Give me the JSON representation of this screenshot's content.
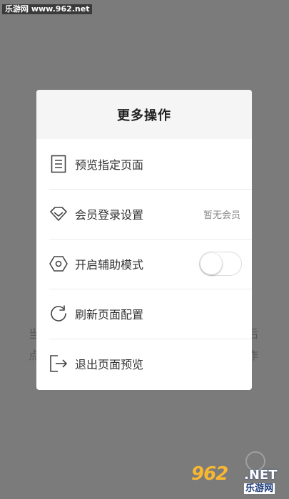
{
  "watermark": {
    "top": "乐游网 www.962.net",
    "bottom_logo": "962",
    "bottom_net": ".NET",
    "bottom_cn": "乐游网"
  },
  "background": {
    "left_1": "当",
    "left_2": "点",
    "right_1": "后",
    "right_2": "作"
  },
  "dialog": {
    "title": "更多操作",
    "items": [
      {
        "label": "预览指定页面",
        "icon": "document-icon"
      },
      {
        "label": "会员登录设置",
        "icon": "diamond-icon",
        "value": "暂无会员"
      },
      {
        "label": "开启辅助模式",
        "icon": "hexagon-icon",
        "toggle": false
      },
      {
        "label": "刷新页面配置",
        "icon": "refresh-icon"
      },
      {
        "label": "退出页面预览",
        "icon": "exit-icon"
      }
    ]
  },
  "colors": {
    "overlay": "#7b7b7b",
    "header_bg": "#f5f5f5",
    "text": "#333333",
    "secondary": "#888888"
  }
}
